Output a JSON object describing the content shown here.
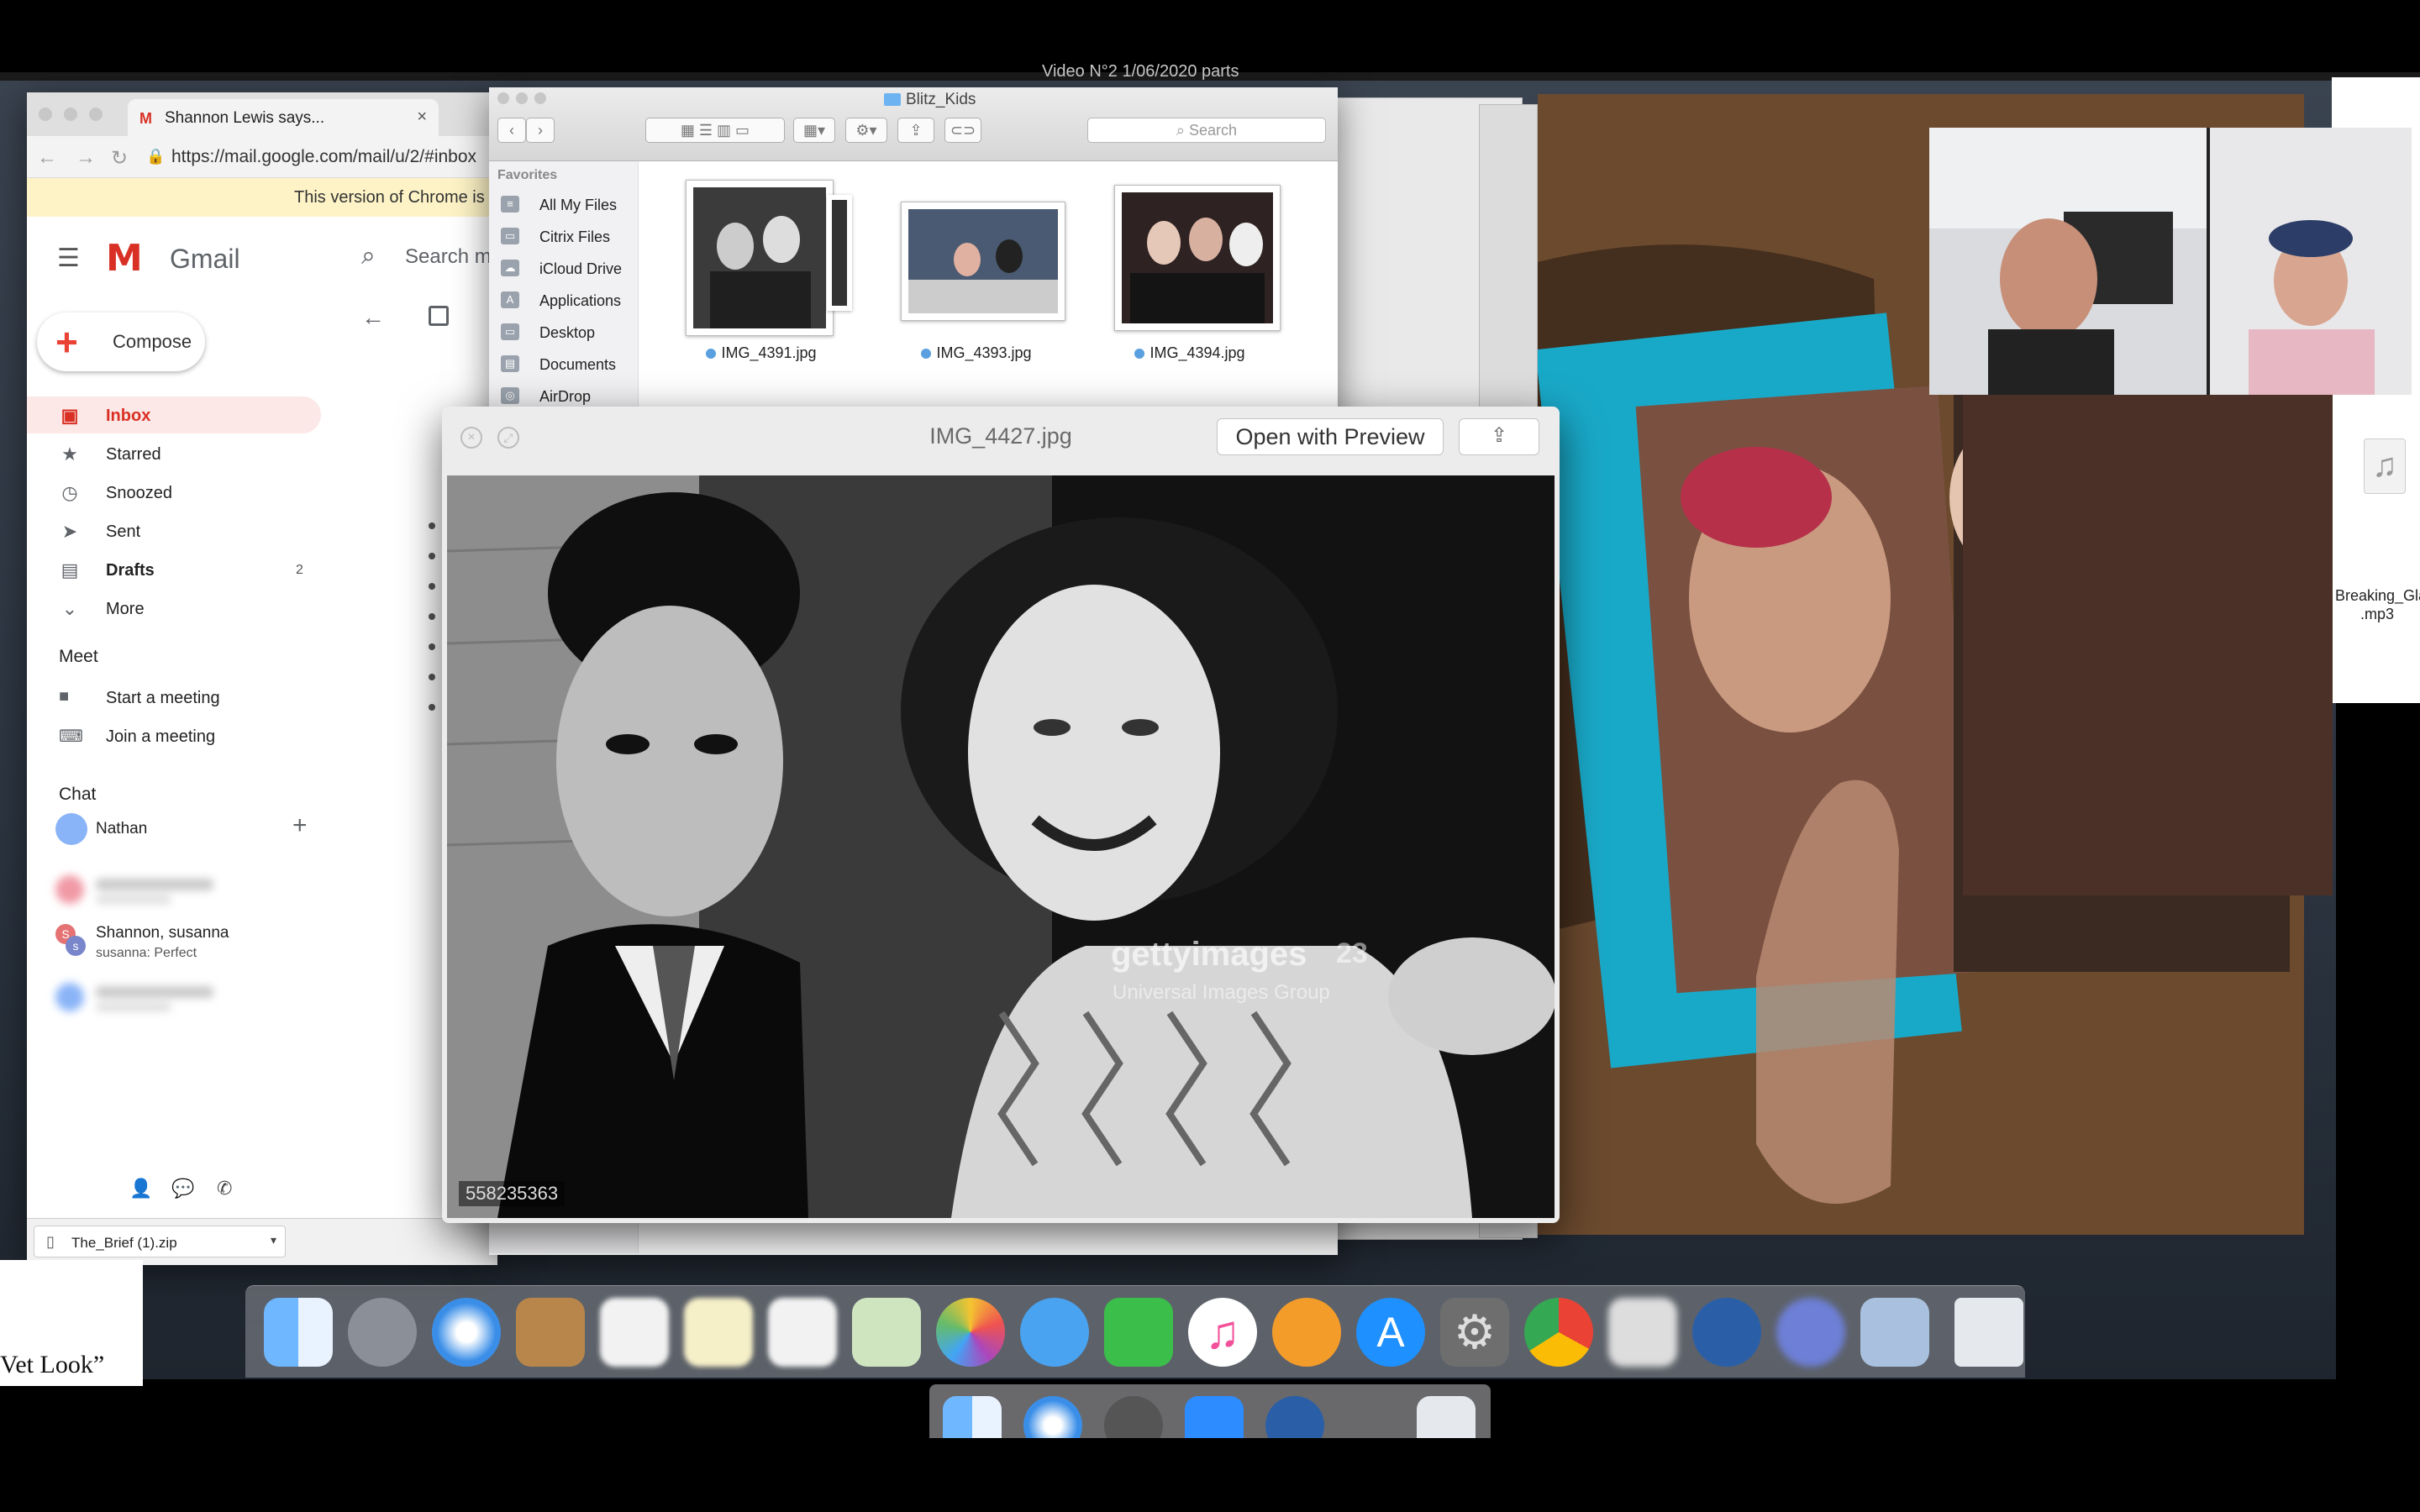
{
  "menubar": {
    "title": "Video N°2 1/06/2020 parts"
  },
  "desktop": {
    "left_text": "Vet Look”",
    "right_file_label": "Breaking_Gla\n.mp3"
  },
  "chrome": {
    "tab_title": "Shannon Lewis says...",
    "url": "https://mail.google.com/mail/u/2/#inbox",
    "warning": "This version of Chrome is",
    "download_file": "The_Brief (1).zip"
  },
  "gmail": {
    "logo_text": "Gmail",
    "search_placeholder": "Search m",
    "compose_label": "Compose",
    "nav": [
      {
        "label": "Inbox",
        "icon": "inbox-icon",
        "count": ""
      },
      {
        "label": "Starred",
        "icon": "star-icon",
        "count": ""
      },
      {
        "label": "Snoozed",
        "icon": "clock-icon",
        "count": ""
      },
      {
        "label": "Sent",
        "icon": "send-icon",
        "count": ""
      },
      {
        "label": "Drafts",
        "icon": "draft-icon",
        "count": "2"
      },
      {
        "label": "More",
        "icon": "chevron-down-icon",
        "count": ""
      }
    ],
    "meet_heading": "Meet",
    "meet_items": [
      {
        "label": "Start a meeting",
        "icon": "video-icon"
      },
      {
        "label": "Join a meeting",
        "icon": "keyboard-icon"
      }
    ],
    "chat_heading": "Chat",
    "chat_user": "Nathan",
    "chat_conversation": {
      "name": "Shannon, susanna",
      "snippet": "susanna: Perfect",
      "avatar1": "S",
      "avatar2": "s"
    }
  },
  "finder": {
    "title": "Blitz_Kids",
    "search_placeholder": "Search",
    "favorites_heading": "Favorites",
    "favorites": [
      "All My Files",
      "Citrix Files",
      "iCloud Drive",
      "Applications",
      "Desktop",
      "Documents",
      "AirDrop"
    ],
    "files": [
      "IMG_4391.jpg",
      "IMG_4393.jpg",
      "IMG_4394.jpg"
    ]
  },
  "quicklook": {
    "title": "IMG_4427.jpg",
    "open_button": "Open with Preview",
    "image_id": "558235363",
    "watermark": "gettyimages",
    "watermark_sub": "Universal Images Group",
    "watermark_num": "23"
  },
  "dock": {
    "apps": [
      "finder-icon",
      "launchpad-icon",
      "safari-icon",
      "contacts-icon",
      "calendar-icon",
      "notes-icon",
      "reminders-icon",
      "maps-icon",
      "photos-icon",
      "messages-icon",
      "facetime-icon",
      "music-icon",
      "books-icon",
      "app-store-icon",
      "system-preferences-icon",
      "chrome-icon",
      "blurred-app-icon",
      "quicktime-icon",
      "blurred-app-icon",
      "preview-icon",
      "trash-icon"
    ]
  },
  "colors": {
    "gmail_red": "#d93025",
    "finder_blue": "#5aa0e0",
    "warn_bg": "#fdf3c6"
  }
}
